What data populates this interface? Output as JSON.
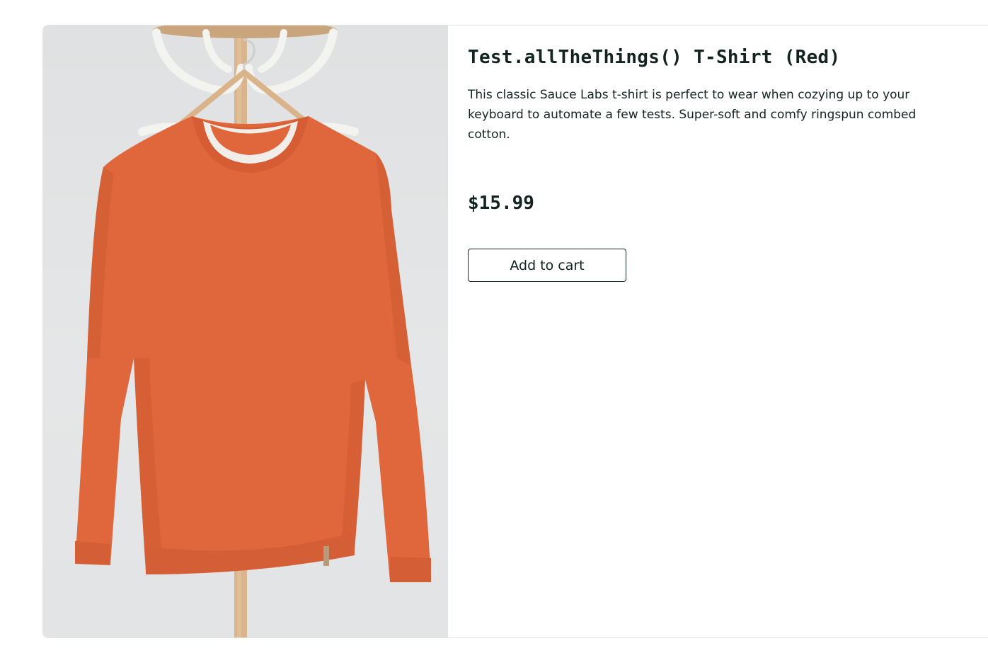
{
  "product": {
    "name": "Test.allTheThings() T-Shirt (Red)",
    "description": "This classic Sauce Labs t-shirt is perfect to wear when cozying up to your keyboard to automate a few tests. Super-soft and comfy ringspun combed cotton.",
    "price": "$15.99",
    "image_icon": "red-sweatshirt-on-hanger-image",
    "color": "#e0673c"
  },
  "actions": {
    "add_to_cart_label": "Add to cart"
  },
  "theme": {
    "text": "#132322",
    "border": "#e3e3e3"
  }
}
